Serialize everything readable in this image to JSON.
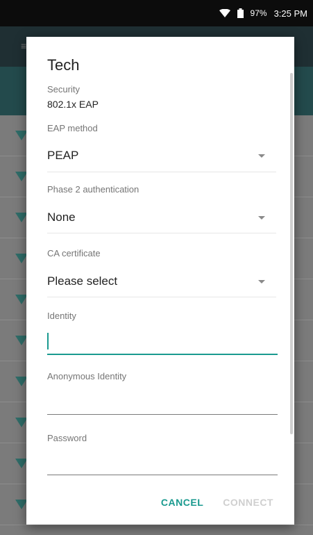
{
  "status_bar": {
    "battery": "97%",
    "time": "3:25 PM"
  },
  "dialog": {
    "title": "Tech",
    "security_label": "Security",
    "security_value": "802.1x EAP",
    "eap_method_label": "EAP method",
    "eap_method_value": "PEAP",
    "phase2_label": "Phase 2 authentication",
    "phase2_value": "None",
    "ca_cert_label": "CA certificate",
    "ca_cert_value": "Please select",
    "identity_label": "Identity",
    "identity_value": "",
    "anonymous_identity_label": "Anonymous Identity",
    "anonymous_identity_value": "",
    "password_label": "Password",
    "password_value": "",
    "cancel_button": "CANCEL",
    "connect_button": "CONNECT"
  },
  "colors": {
    "accent": "#1a9a8f",
    "disabled": "#cfcfcf"
  }
}
